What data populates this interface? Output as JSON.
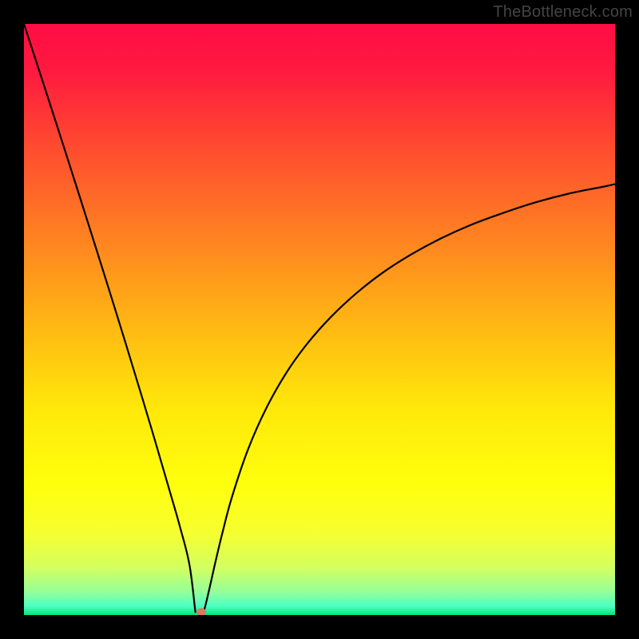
{
  "attribution": "TheBottleneck.com",
  "chart_data": {
    "type": "line",
    "title": "",
    "xlabel": "",
    "ylabel": "",
    "xlim": [
      0,
      100
    ],
    "ylim": [
      0,
      100
    ],
    "grid": false,
    "legend": false,
    "series": [
      {
        "name": "left-branch",
        "x": [
          0,
          3.1,
          6.2,
          9.3,
          12.4,
          15.5,
          18.6,
          21.7,
          24.8,
          26.4,
          28.0,
          29.0
        ],
        "y": [
          100,
          90.5,
          80.9,
          71.2,
          61.4,
          51.5,
          41.4,
          31.1,
          20.5,
          14.9,
          8.5,
          0.5
        ]
      },
      {
        "name": "right-branch",
        "x": [
          30.4,
          30.8,
          31.5,
          32.4,
          33.6,
          35.2,
          37.9,
          41.0,
          44.4,
          48.0,
          52.0,
          56.3,
          60.8,
          65.5,
          70.5,
          75.6,
          81.0,
          86.5,
          92.2,
          98.2,
          100.0
        ],
        "y": [
          0.5,
          2.0,
          5.0,
          9.0,
          14.0,
          20.0,
          28.0,
          35.0,
          41.0,
          46.0,
          50.5,
          54.5,
          58.0,
          61.0,
          63.7,
          66.0,
          68.0,
          69.8,
          71.3,
          72.5,
          72.9
        ]
      }
    ],
    "marker": {
      "x": 30.0,
      "y": 0.5,
      "color": "#d87a5c"
    },
    "background_gradient": {
      "stops": [
        {
          "offset": 0.0,
          "color": "#ff0d44"
        },
        {
          "offset": 0.08,
          "color": "#ff1a3f"
        },
        {
          "offset": 0.2,
          "color": "#ff4830"
        },
        {
          "offset": 0.35,
          "color": "#ff7e22"
        },
        {
          "offset": 0.5,
          "color": "#ffb414"
        },
        {
          "offset": 0.65,
          "color": "#ffe80a"
        },
        {
          "offset": 0.78,
          "color": "#ffff0d"
        },
        {
          "offset": 0.86,
          "color": "#f6ff2f"
        },
        {
          "offset": 0.92,
          "color": "#d3ff60"
        },
        {
          "offset": 0.96,
          "color": "#96ff98"
        },
        {
          "offset": 0.985,
          "color": "#4dffc4"
        },
        {
          "offset": 1.0,
          "color": "#00e676"
        }
      ]
    }
  }
}
